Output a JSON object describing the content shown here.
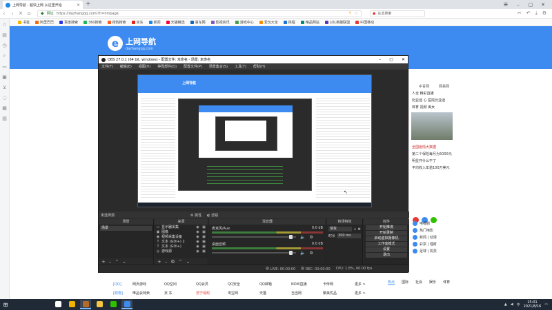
{
  "browser": {
    "tab_title": "上网导航 - 超快上网 从这里开始",
    "tab_close": "×",
    "new_tab": "+",
    "secure_label": "网址",
    "url": "https://dazhangqq.com/?h=hmpage",
    "search_placeholder": "在此搜索",
    "bookmarks": [
      {
        "label": "书签",
        "color": "#f5b400"
      },
      {
        "label": "阿里巴巴",
        "color": "#ff6a00"
      },
      {
        "label": "百度搜索",
        "color": "#2932e1"
      },
      {
        "label": "360搜索",
        "color": "#19b955"
      },
      {
        "label": "搜狗搜索",
        "color": "#fb6022"
      },
      {
        "label": "京东",
        "color": "#e1251b"
      },
      {
        "label": "新闻",
        "color": "#1e88e5"
      },
      {
        "label": "天猫精选",
        "color": "#ff0036"
      },
      {
        "label": "易车网",
        "color": "#1565c0"
      },
      {
        "label": "影视资讯",
        "color": "#7e57c2"
      },
      {
        "label": "游戏中心",
        "color": "#43a047"
      },
      {
        "label": "爱玩大全",
        "color": "#fb8c00"
      },
      {
        "label": "携程",
        "color": "#1976d2"
      },
      {
        "label": "精品网站",
        "color": "#00897b"
      },
      {
        "label": "LOL英雄联盟",
        "color": "#5e35b1"
      },
      {
        "label": "中国移动",
        "color": "#e53935"
      }
    ]
  },
  "page": {
    "logo_title": "上网导航",
    "logo_sub": "dazhangqq.com",
    "right_tabs": [
      "中青网",
      "网易网"
    ],
    "right_items": [
      {
        "text": "人全  精彩直播",
        "red": false
      },
      {
        "text": "比亚迪 心 医院比亚迪",
        "red": false
      },
      {
        "text": "体育  视频  美女",
        "red": false
      },
      {
        "text": "全国疫情大数据",
        "red": true
      },
      {
        "text": "第二个保险每月为5000元",
        "red": false
      },
      {
        "text": "明星开什么不了",
        "red": false
      },
      {
        "text": "平均收入年逾100万美元",
        "red": false
      }
    ],
    "side_items": [
      "电视剧",
      "热门电影",
      "新闻 | 动漫",
      "彩票 | 理财",
      "足球 | 机票"
    ],
    "bottom_tabs": [
      "热点",
      "国际",
      "社会",
      "娱乐",
      "体育"
    ],
    "bottom_rows": [
      [
        "[QQ]",
        "网页游戏",
        "QQ空间",
        "QQ会员",
        "QQ安全",
        "QQ邮箱",
        "NOW直播",
        "卡传网",
        "更多 >"
      ],
      [
        "[购物]",
        "唯品会特卖",
        "京 东",
        "苏宁易购",
        "淘宝网",
        "天猫",
        "当当网",
        "聚美优品",
        "更多 >"
      ]
    ]
  },
  "obs": {
    "title": "OBS 27.0.1 (64 bit, windows) - 配置文件: 未命名 - 场景: 未命名",
    "menu": [
      "文件(F)",
      "编辑(E)",
      "视图(V)",
      "停靠部件(D)",
      "配置文件(P)",
      "场景集合(S)",
      "工具(T)",
      "帮助(H)"
    ],
    "preview_logo": "上网导航",
    "toolbar_left": "未选择源",
    "toolbar_props": "属性",
    "toolbar_filters": "滤镜",
    "docks": {
      "scenes": "场景",
      "sources": "来源",
      "mixer": "混音器",
      "transition": "转场特效",
      "controls": "控件"
    },
    "scenes": [
      "场景"
    ],
    "sources": [
      {
        "icon": "▭",
        "name": "显示器采集"
      },
      {
        "icon": "▣",
        "name": "图像"
      },
      {
        "icon": "◉",
        "name": "视频采集设备"
      },
      {
        "icon": "T",
        "name": "文本 (GDI+) 2"
      },
      {
        "icon": "T",
        "name": "文本 (GDI+)"
      },
      {
        "icon": "◎",
        "name": "游戏源"
      }
    ],
    "mixer": [
      {
        "name": "麦克风/Aux",
        "db": "0.0 dB"
      },
      {
        "name": "桌面音频",
        "db": "0.0 dB"
      }
    ],
    "transition": {
      "type": "渐变",
      "duration_label": "时长",
      "duration": "300 ms"
    },
    "controls": [
      "开始推流",
      "开始录制",
      "启动虚拟摄像机",
      "工作室模式",
      "设置",
      "退出"
    ],
    "status": {
      "live": "LIVE: 00:00:00",
      "rec": "REC: 00:00:00",
      "cpu": "CPU: 1.8%, 60.00 fps"
    }
  },
  "taskbar": {
    "time": "15:01",
    "date": "2021/8/16",
    "apps": [
      {
        "name": "windows-icon",
        "color": "#ffffff",
        "active": false
      },
      {
        "name": "chrome-icon",
        "color": "#f0b400",
        "active": false
      },
      {
        "name": "obs-icon",
        "color": "#b36b2a",
        "active": true
      },
      {
        "name": "explorer-icon",
        "color": "#f5c542",
        "active": false
      },
      {
        "name": "wechat-icon",
        "color": "#2dc100",
        "active": false
      },
      {
        "name": "browser-icon",
        "color": "#3d8af0",
        "active": true
      }
    ],
    "lang": "中"
  }
}
